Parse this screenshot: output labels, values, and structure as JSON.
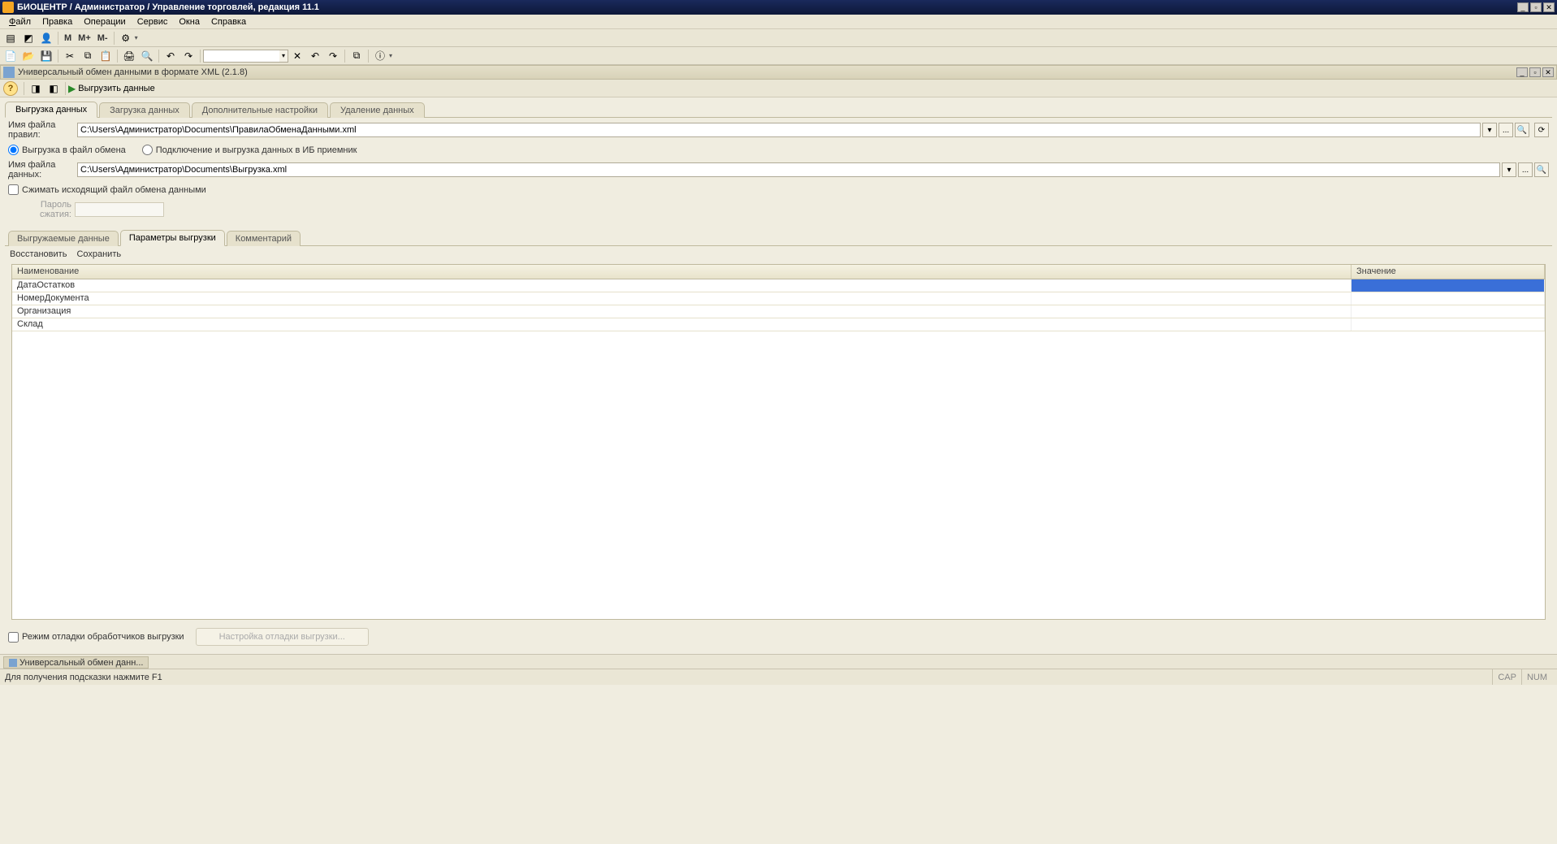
{
  "window": {
    "title": "БИОЦЕНТР / Администратор / Управление торговлей, редакция 11.1"
  },
  "menubar": {
    "file": "Файл",
    "edit": "Правка",
    "operations": "Операции",
    "service": "Сервис",
    "windows": "Окна",
    "help": "Справка"
  },
  "toolbar1": {
    "m": "M",
    "m_plus": "M+",
    "m_minus": "M-"
  },
  "document": {
    "title": "Универсальный обмен данными в формате XML (2.1.8)",
    "export_action": "Выгрузить данные"
  },
  "main_tabs": {
    "export": "Выгрузка данных",
    "import": "Загрузка данных",
    "extra": "Дополнительные настройки",
    "delete": "Удаление данных"
  },
  "fields": {
    "rules_label": "Имя файла правил:",
    "rules_value": "C:\\Users\\Администратор\\Documents\\ПравилаОбменаДанными.xml",
    "radio_file": "Выгрузка в файл обмена",
    "radio_connect": "Подключение и выгрузка данных в ИБ приемник",
    "data_label": "Имя файла данных:",
    "data_value": "C:\\Users\\Администратор\\Documents\\Выгрузка.xml",
    "compress": "Сжимать исходящий файл обмена данными",
    "pw_label": "Пароль сжатия:"
  },
  "sub_tabs": {
    "exported": "Выгружаемые данные",
    "params": "Параметры выгрузки",
    "comment": "Комментарий"
  },
  "sub_toolbar": {
    "restore": "Восстановить",
    "save": "Сохранить"
  },
  "grid": {
    "col_name": "Наименование",
    "col_value": "Значение",
    "rows": [
      "ДатаОстатков",
      "НомерДокумента",
      "Организация",
      "Склад"
    ]
  },
  "bottom": {
    "debug_mode": "Режим отладки обработчиков выгрузки",
    "debug_settings": "Настройка отладки выгрузки..."
  },
  "window_tab": "Универсальный обмен данн...",
  "statusbar": {
    "hint": "Для получения подсказки нажмите F1",
    "cap": "CAP",
    "num": "NUM"
  }
}
